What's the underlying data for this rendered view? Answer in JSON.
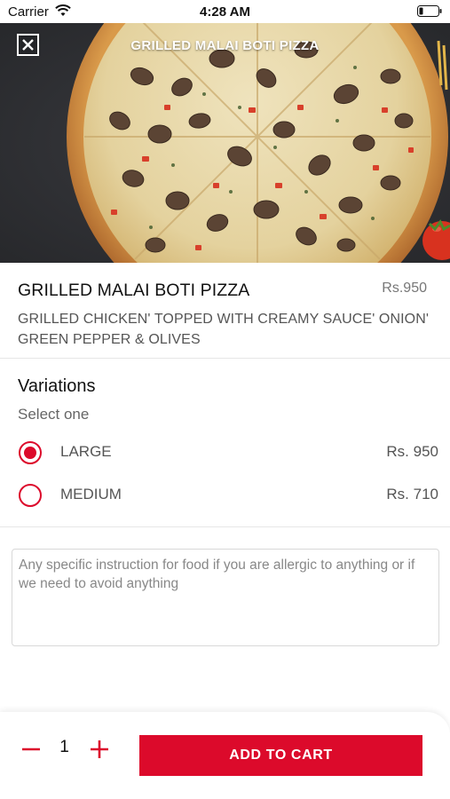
{
  "status_bar": {
    "carrier": "Carrier",
    "time": "4:28 AM"
  },
  "hero": {
    "title": "GRILLED MALAI BOTI PIZZA",
    "close_icon": "close-icon",
    "image_subject": "pizza"
  },
  "product": {
    "name": "GRILLED MALAI BOTI PIZZA",
    "price": "Rs.950",
    "description": "GRILLED CHICKEN' TOPPED WITH CREAMY SAUCE' ONION' GREEN PEPPER & OLIVES"
  },
  "variations": {
    "title": "Variations",
    "subtitle": "Select one",
    "options": [
      {
        "label": "LARGE",
        "price": "Rs. 950",
        "selected": true
      },
      {
        "label": "MEDIUM",
        "price": "Rs. 710",
        "selected": false
      }
    ]
  },
  "instructions": {
    "placeholder": "Any specific instruction for food if you are allergic to anything or if we need to avoid anything",
    "value": ""
  },
  "cart": {
    "quantity": "1",
    "add_label": "ADD TO CART"
  },
  "colors": {
    "accent": "#dc0a2b",
    "hero_bg": "#2f3034"
  }
}
